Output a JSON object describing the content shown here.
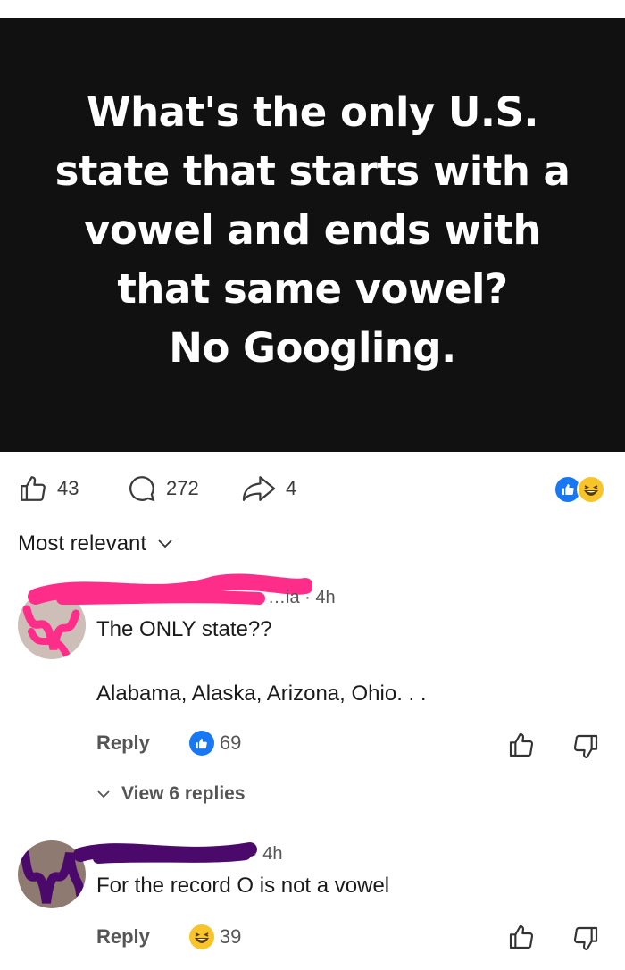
{
  "post": {
    "image_text_lines": [
      "What's the only U.S.",
      "state that starts with a",
      "vowel and ends with",
      "that same vowel?",
      "No Googling."
    ]
  },
  "actions": {
    "likes": "43",
    "comments": "272",
    "shares": "4",
    "reactions": [
      "like-icon",
      "haha-icon"
    ]
  },
  "sort": {
    "label": "Most relevant"
  },
  "comments": [
    {
      "author_visible": "…ia",
      "time": "4h",
      "text_line1": "The ONLY state??",
      "text_line2": "Alabama, Alaska, Arizona, Ohio. . .",
      "reply_label": "Reply",
      "reaction_count": "69",
      "reaction": "like-icon",
      "view_replies": "View 6 replies"
    },
    {
      "author_visible": "",
      "time": "4h",
      "text_line1": "For the record O is not a vowel",
      "reply_label": "Reply",
      "reaction_count": "39",
      "reaction": "haha-icon"
    }
  ],
  "colors": {
    "brand_blue": "#1877f2",
    "haha_yellow": "#f7c52b",
    "redact_pink": "#ff2d8a",
    "redact_purple": "#4b0a6b"
  }
}
